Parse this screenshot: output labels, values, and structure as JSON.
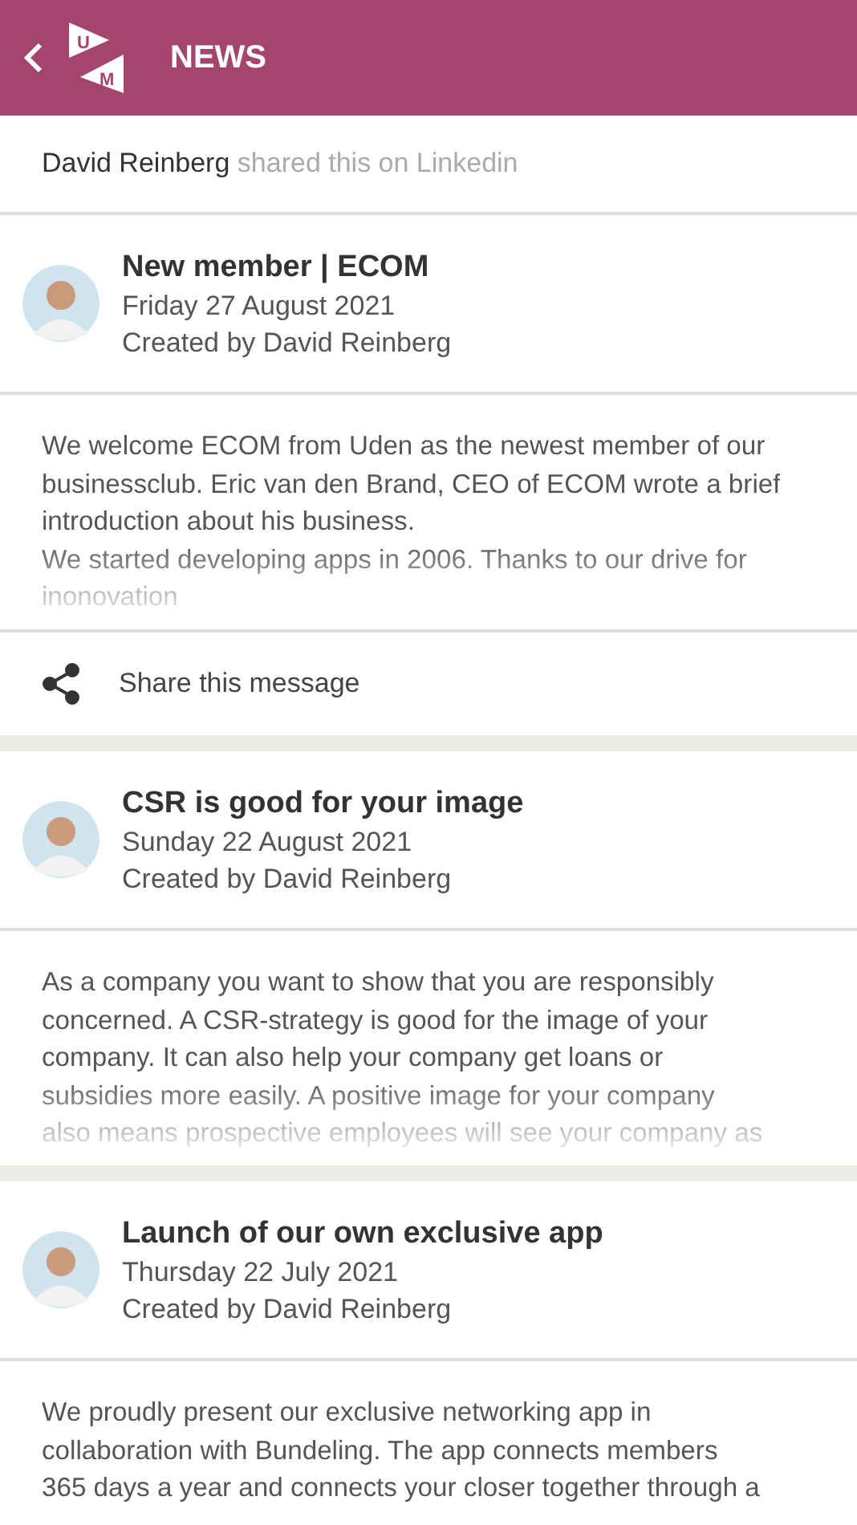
{
  "header": {
    "title": "NEWS",
    "logo_letters": [
      "U",
      "M"
    ]
  },
  "shared": {
    "author": "David Reinberg",
    "text": "shared this on Linkedin"
  },
  "articles": [
    {
      "title": "New member | ECOM",
      "date": "Friday 27 August 2021",
      "created_by": "Created by David Reinberg",
      "lines": [
        "We welcome ECOM from Uden as the newest member of our",
        "businessclub. Eric van den Brand, CEO of ECOM wrote a brief",
        "introduction about his business.",
        "We started developing apps in 2006. Thanks to our drive for",
        "inonovation"
      ],
      "share": "Share this message"
    },
    {
      "title": "CSR is good for your image",
      "date": "Sunday 22 August 2021",
      "created_by": "Created by David Reinberg",
      "lines": [
        "As a company you want to show that you are responsibly",
        "concerned. A CSR-strategy is good for the image of your",
        "company. It can also help your company get loans or",
        "subsidies more easily. A positive image for your company",
        "also means prospective employees will see your company as"
      ]
    },
    {
      "title": "Launch of our own exclusive app",
      "date": "Thursday 22 July 2021",
      "created_by": "Created by David Reinberg",
      "lines": [
        "We proudly present our exclusive networking app in",
        "collaboration with Bundeling. The app connects members",
        "365 days a year and connects your closer together through a"
      ]
    }
  ]
}
